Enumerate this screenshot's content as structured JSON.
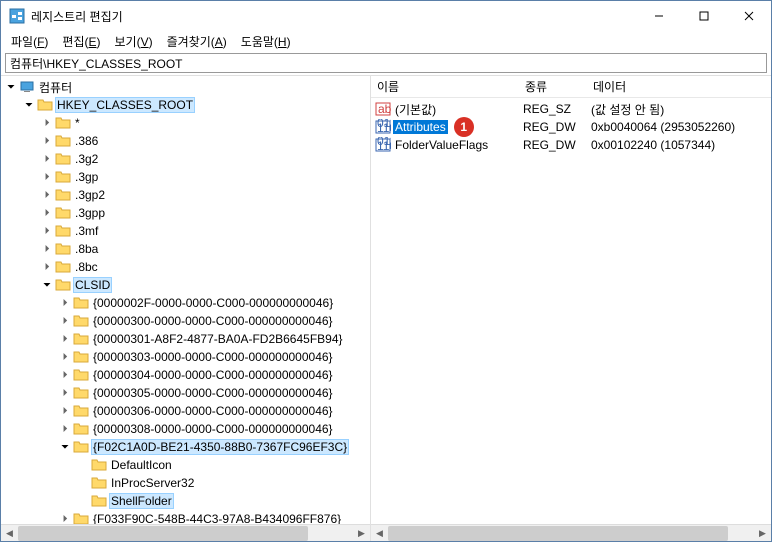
{
  "title": "레지스트리 편집기",
  "menu": [
    {
      "label": "파일",
      "key": "F"
    },
    {
      "label": "편집",
      "key": "E"
    },
    {
      "label": "보기",
      "key": "V"
    },
    {
      "label": "즐겨찾기",
      "key": "A"
    },
    {
      "label": "도움말",
      "key": "H"
    }
  ],
  "address": "컴퓨터\\HKEY_CLASSES_ROOT",
  "tree": {
    "root": "컴퓨터",
    "hkcr": "HKEY_CLASSES_ROOT",
    "items": [
      "*",
      ".386",
      ".3g2",
      ".3gp",
      ".3gp2",
      ".3gpp",
      ".3mf",
      ".8ba",
      ".8bc"
    ],
    "clsid": "CLSID",
    "clsid_items": [
      "{0000002F-0000-0000-C000-000000000046}",
      "{00000300-0000-0000-C000-000000000046}",
      "{00000301-A8F2-4877-BA0A-FD2B6645FB94}",
      "{00000303-0000-0000-C000-000000000046}",
      "{00000304-0000-0000-C000-000000000046}",
      "{00000305-0000-0000-C000-000000000046}",
      "{00000306-0000-0000-C000-000000000046}",
      "{00000308-0000-0000-C000-000000000046}"
    ],
    "sel_clsid": "{F02C1A0D-BE21-4350-88B0-7367FC96EF3C}",
    "sel_children": [
      "DefaultIcon",
      "InProcServer32",
      "ShellFolder"
    ],
    "after": "{F033F90C-548B-44C3-97A8-B434096FF876}"
  },
  "cols": {
    "name": "이름",
    "type": "종류",
    "data": "데이터"
  },
  "values": [
    {
      "name": "(기본값)",
      "type": "REG_SZ",
      "data": "(값 설정 안 됨)",
      "kind": "str",
      "sel": false
    },
    {
      "name": "Attributes",
      "type": "REG_DW",
      "data": "0xb0040064 (2953052260)",
      "kind": "bin",
      "sel": true,
      "badge": "1"
    },
    {
      "name": "FolderValueFlags",
      "type": "REG_DW",
      "data": "0x00102240 (1057344)",
      "kind": "bin",
      "sel": false
    }
  ]
}
